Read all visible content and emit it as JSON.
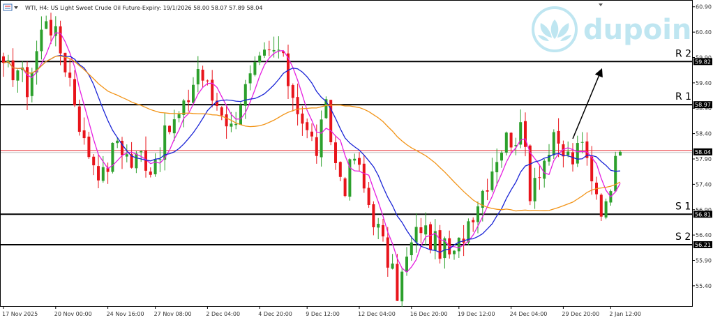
{
  "header": {
    "title": "WTI, H4:  US Light Sweet Crude Oil Future-Expiry: 19/1/2026  58.00 58.07 57.89 58.04"
  },
  "logo": {
    "text": "dupoin",
    "color": "#bfe6f1"
  },
  "colors": {
    "bull": "#2ca02c",
    "bear": "#e8141b",
    "ma_fast": "#e61ee0",
    "ma_mid": "#1a24d6",
    "ma_slow": "#f29418",
    "level": "#000000",
    "price_line": "#e8141b"
  },
  "chart_data": {
    "type": "candlestick",
    "instrument": "WTI",
    "timeframe": "H4",
    "ylim": [
      55.0,
      61.02
    ],
    "y_ticks": [
      "60.90",
      "60.40",
      "59.90",
      "59.40",
      "58.90",
      "58.40",
      "57.90",
      "57.40",
      "56.90",
      "56.40",
      "55.90",
      "55.40"
    ],
    "x_ticks": [
      "17 Nov 2025",
      "20 Nov 00:00",
      "24 Nov 16:00",
      "27 Nov 08:00",
      "2 Dec 04:00",
      "4 Dec 20:00",
      "9 Dec 12:00",
      "12 Dec 04:00",
      "16 Dec 20:00",
      "19 Dec 12:00",
      "24 Dec 04:00",
      "29 Dec 20:00",
      "2 Jan 12:00"
    ],
    "levels": [
      {
        "name": "R 2",
        "value": 59.82,
        "tag": "59.82"
      },
      {
        "name": "R 1",
        "value": 58.97,
        "tag": "58.97"
      },
      {
        "name": "S 1",
        "value": 56.81,
        "tag": "56.81"
      },
      {
        "name": "S 2",
        "value": 56.21,
        "tag": "56.21"
      }
    ],
    "current_price": {
      "value": 58.04,
      "tag": "58.04"
    },
    "price_anchors": [
      [
        0,
        59.6
      ],
      [
        3,
        59.7
      ],
      [
        5,
        59.3
      ],
      [
        9,
        60.75
      ],
      [
        11,
        60.3
      ],
      [
        14,
        59.5
      ],
      [
        17,
        58.2
      ],
      [
        21,
        57.55
      ],
      [
        24,
        58.3
      ],
      [
        27,
        57.8
      ],
      [
        29,
        58.0
      ],
      [
        31,
        57.75
      ],
      [
        35,
        58.5
      ],
      [
        38,
        58.85
      ],
      [
        41,
        59.7
      ],
      [
        44,
        59.1
      ],
      [
        46,
        58.9
      ],
      [
        48,
        58.5
      ],
      [
        50,
        59.1
      ],
      [
        53,
        59.6
      ],
      [
        55,
        59.9
      ],
      [
        58,
        60.05
      ],
      [
        60,
        59.45
      ],
      [
        62,
        58.95
      ],
      [
        64,
        58.4
      ],
      [
        66,
        58.1
      ],
      [
        68,
        58.85
      ],
      [
        70,
        57.8
      ],
      [
        72,
        57.4
      ],
      [
        74,
        57.95
      ],
      [
        76,
        57.3
      ],
      [
        79,
        56.5
      ],
      [
        81,
        55.9
      ],
      [
        83,
        55.3
      ],
      [
        84,
        55.6
      ],
      [
        86,
        56.2
      ],
      [
        88,
        56.6
      ],
      [
        90,
        56.3
      ],
      [
        93,
        56.1
      ],
      [
        95,
        55.95
      ],
      [
        96,
        56.2
      ],
      [
        98,
        56.7
      ],
      [
        100,
        57.1
      ],
      [
        102,
        57.5
      ],
      [
        104,
        58.0
      ],
      [
        106,
        58.3
      ],
      [
        109,
        58.4
      ],
      [
        110,
        58.1
      ],
      [
        111,
        57.3
      ],
      [
        112,
        57.6
      ],
      [
        114,
        57.9
      ],
      [
        116,
        58.2
      ],
      [
        118,
        58.0
      ],
      [
        120,
        57.9
      ],
      [
        122,
        58.15
      ],
      [
        124,
        57.6
      ],
      [
        126,
        57.0
      ],
      [
        127,
        56.9
      ],
      [
        128,
        57.5
      ],
      [
        129,
        58.2
      ],
      [
        130,
        58.04
      ]
    ],
    "moving_averages": [
      {
        "color_key": "ma_fast",
        "period": 5
      },
      {
        "color_key": "ma_mid",
        "period": 12
      },
      {
        "color_key": "ma_slow",
        "period": 40
      }
    ],
    "annotation": {
      "type": "arrow",
      "direction": "up",
      "from": [
        120,
        58.3
      ],
      "to": [
        126,
        59.65
      ]
    }
  }
}
